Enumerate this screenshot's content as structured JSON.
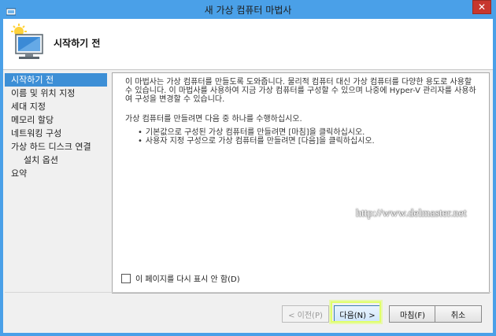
{
  "window": {
    "title": "새 가상 컴퓨터 마법사",
    "close_symbol": "✕"
  },
  "header": {
    "title": "시작하기 전"
  },
  "sidebar": {
    "items": [
      {
        "label": "시작하기 전",
        "active": true
      },
      {
        "label": "이름 및 위치 지정"
      },
      {
        "label": "세대 지정"
      },
      {
        "label": "메모리 할당"
      },
      {
        "label": "네트워킹 구성"
      },
      {
        "label": "가상 하드 디스크 연결"
      },
      {
        "label": "설치 옵션",
        "indent": true
      },
      {
        "label": "요약"
      }
    ]
  },
  "content": {
    "paragraph1": "이 마법사는 가상 컴퓨터를 만들도록 도와줍니다. 물리적 컴퓨터 대신 가상 컴퓨터를 다양한 용도로 사용할 수 있습니다. 이 마법사를 사용하여 지금 가상 컴퓨터를 구성할 수 있으며 나중에 Hyper-V 관리자를 사용하여 구성을 변경할 수 있습니다.",
    "paragraph2": "가상 컴퓨터를 만들려면 다음 중 하나를 수행하십시오.",
    "bullets": [
      "기본값으로 구성된 가상 컴퓨터를 만들려면 [마침]을 클릭하십시오.",
      "사용자 지정 구성으로 가상 컴퓨터를 만들려면 [다음]을 클릭하십시오."
    ],
    "watermark": "http://www.delmaster.net"
  },
  "checkbox": {
    "label": "이 페이지를 다시 표시 안 함(D)",
    "checked": false
  },
  "buttons": {
    "prev": "< 이전(P)",
    "next": "다음(N) >",
    "finish": "마침(F)",
    "cancel": "취소"
  },
  "colors": {
    "title_bar": "#4aa0e8",
    "active_item": "#3d8fd6",
    "close": "#c7372e",
    "highlight": "#e0ff6a"
  }
}
